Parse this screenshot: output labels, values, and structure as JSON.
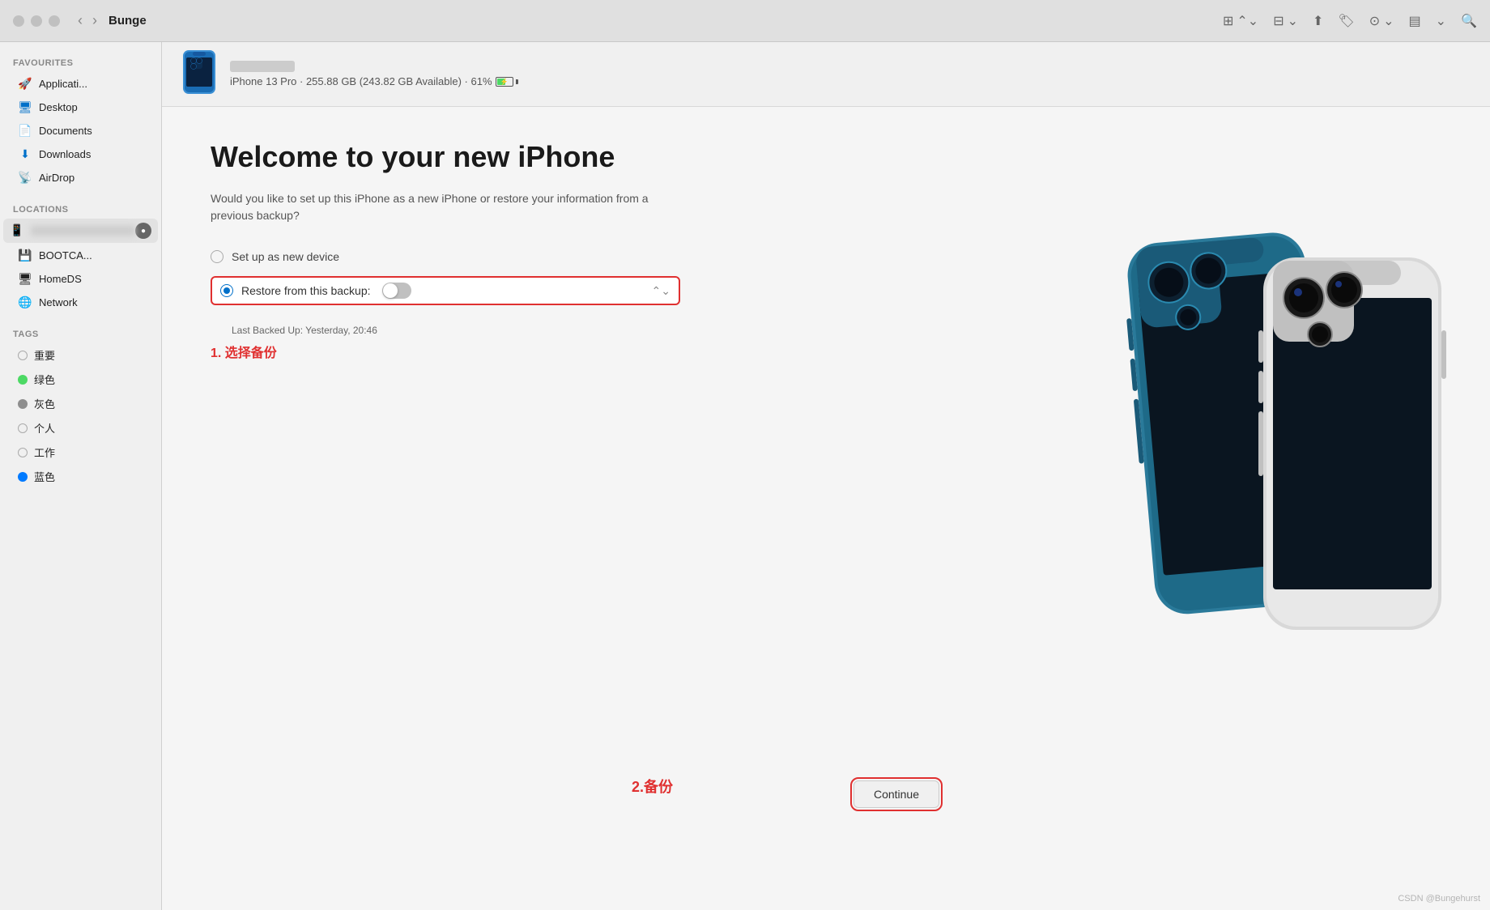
{
  "titlebar": {
    "title": "Bunge",
    "back_label": "‹",
    "forward_label": "›"
  },
  "sidebar": {
    "favourites_label": "Favourites",
    "locations_label": "Locations",
    "tags_label": "Tags",
    "items": [
      {
        "id": "applications",
        "label": "Applicati...",
        "icon": "🚀",
        "color": "#0070c9"
      },
      {
        "id": "desktop",
        "label": "Desktop",
        "icon": "🖥",
        "color": "#0070c9"
      },
      {
        "id": "documents",
        "label": "Documents",
        "icon": "📄",
        "color": "#888"
      },
      {
        "id": "downloads",
        "label": "Downloads",
        "icon": "⬇",
        "color": "#0070c9"
      },
      {
        "id": "airdrop",
        "label": "AirDrop",
        "icon": "📡",
        "color": "#0070c9"
      }
    ],
    "locations": [
      {
        "id": "device",
        "label": "··· ···",
        "hasBadge": true
      },
      {
        "id": "bootcamp",
        "label": "BOOTCA...",
        "icon": "💾"
      },
      {
        "id": "homeds",
        "label": "HomeDS",
        "icon": "🖥"
      },
      {
        "id": "network",
        "label": "Network",
        "icon": "🌐"
      }
    ],
    "tags": [
      {
        "id": "important",
        "label": "重要",
        "color": null
      },
      {
        "id": "green",
        "label": "绿色",
        "color": "#4cd964"
      },
      {
        "id": "gray",
        "label": "灰色",
        "color": "#8e8e8e"
      },
      {
        "id": "personal",
        "label": "个人",
        "color": null
      },
      {
        "id": "work",
        "label": "工作",
        "color": null
      },
      {
        "id": "blue",
        "label": "蓝色",
        "color": "#007aff"
      }
    ]
  },
  "device_header": {
    "model": "iPhone 13 Pro",
    "storage": "255.88 GB",
    "available": "243.82 GB Available",
    "battery": "61%",
    "details_text": "iPhone 13 Pro · 255.88 GB (243.82 GB Available) · 61%"
  },
  "main": {
    "welcome_title": "Welcome to your new iPhone",
    "welcome_subtitle": "Would you like to set up this iPhone as a new iPhone or restore\nyour information from a previous backup?",
    "option_new": "Set up as new device",
    "option_restore": "Restore from this backup:",
    "last_backup_label": "Last Backed Up: Yesterday, 20:46",
    "continue_label": "Continue",
    "annotation_1": "1. 选择备份",
    "annotation_2": "2.备份"
  },
  "watermark": "CSDN @Bungehurst"
}
